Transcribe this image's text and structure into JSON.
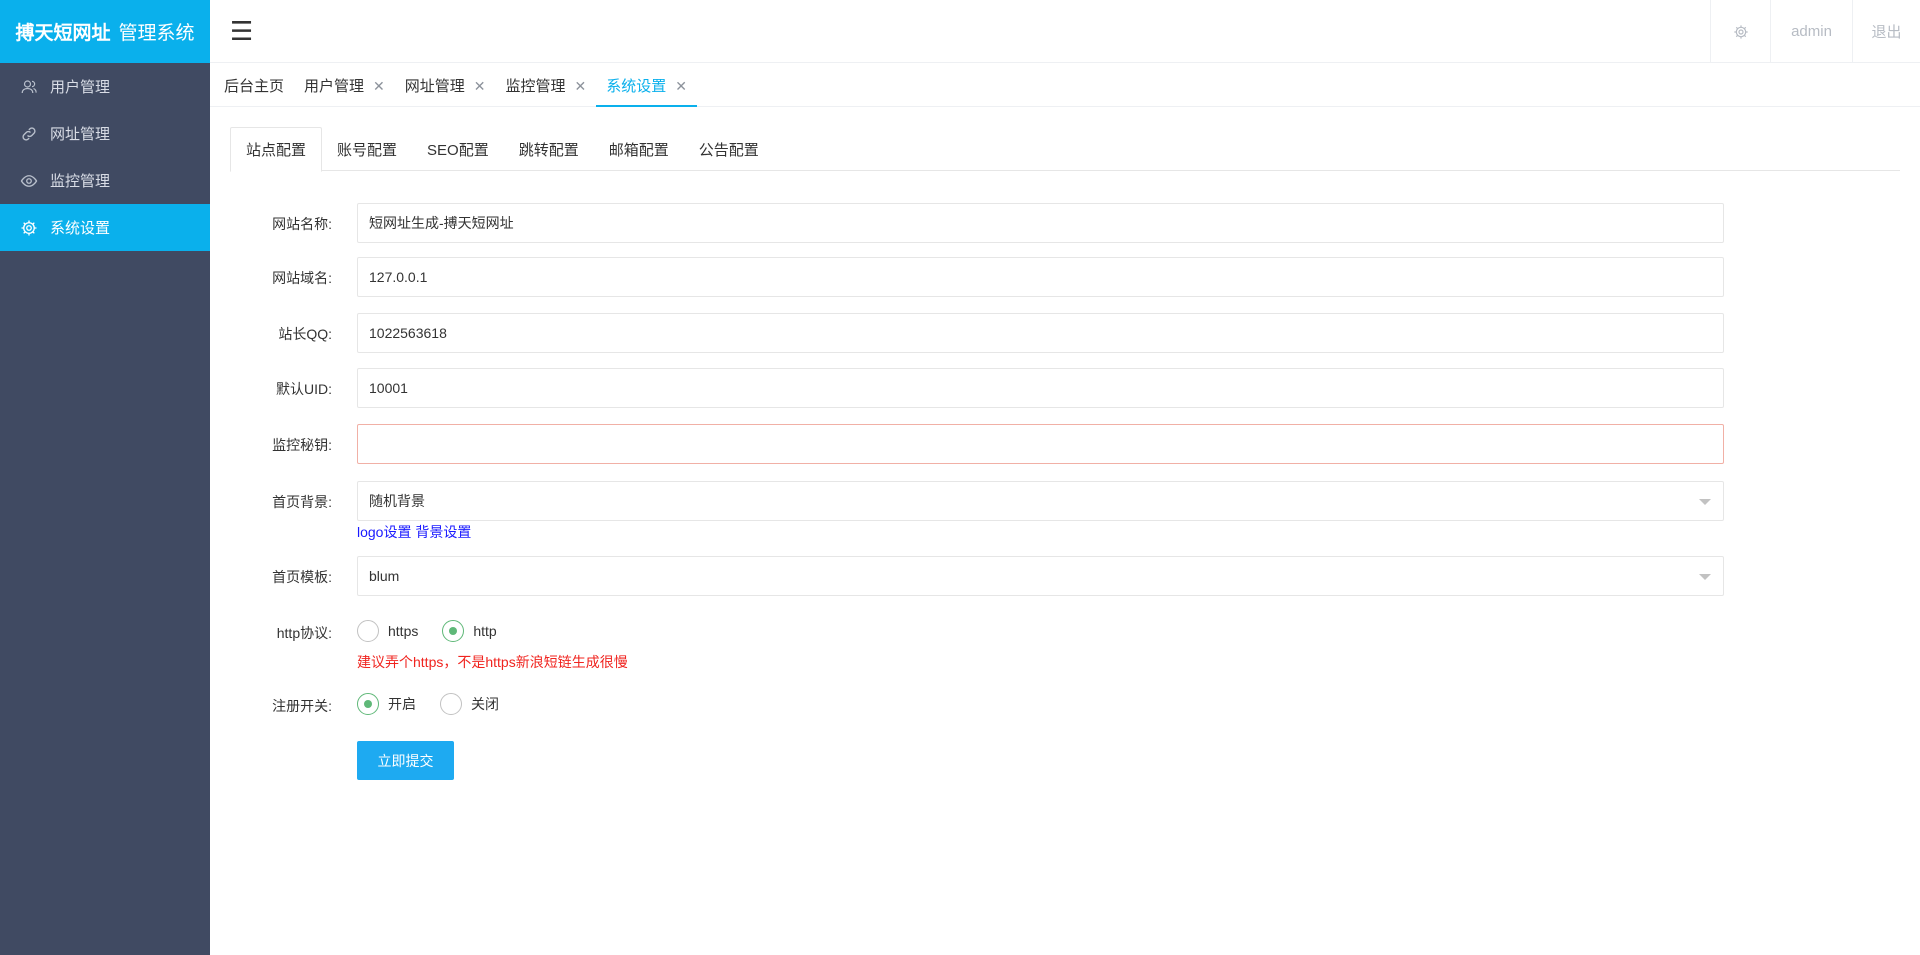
{
  "brand": {
    "name": "搏天短网址",
    "suffix": "管理系统"
  },
  "sidebar": {
    "items": [
      {
        "label": "用户管理",
        "icon": "user-icon",
        "active": false
      },
      {
        "label": "网址管理",
        "icon": "link-icon",
        "active": false
      },
      {
        "label": "监控管理",
        "icon": "eye-icon",
        "active": false
      },
      {
        "label": "系统设置",
        "icon": "gear-icon",
        "active": true
      }
    ]
  },
  "header": {
    "menu_icon": "hamburger-icon",
    "menu_glyph": "☰",
    "settings_icon": "gear-icon",
    "user": "admin",
    "logout": "退出"
  },
  "page_tabs": [
    {
      "label": "后台主页",
      "closable": false,
      "active": false
    },
    {
      "label": "用户管理",
      "closable": true,
      "active": false
    },
    {
      "label": "网址管理",
      "closable": true,
      "active": false
    },
    {
      "label": "监控管理",
      "closable": true,
      "active": false
    },
    {
      "label": "系统设置",
      "closable": true,
      "active": true
    }
  ],
  "close_glyph": "✕",
  "settings_tabs": [
    "站点配置",
    "账号配置",
    "SEO配置",
    "跳转配置",
    "邮箱配置",
    "公告配置"
  ],
  "form": {
    "site_name": {
      "label": "网站名称:",
      "value": "短网址生成-搏天短网址"
    },
    "site_domain": {
      "label": "网站域名:",
      "value": "127.0.0.1"
    },
    "admin_qq": {
      "label": "站长QQ:",
      "value": "1022563618"
    },
    "default_uid": {
      "label": "默认UID:",
      "value": "10001"
    },
    "monitor_key": {
      "label": "监控秘钥:",
      "value": ""
    },
    "home_background": {
      "label": "首页背景:",
      "value": "随机背景"
    },
    "background_links": {
      "logo": "logo设置",
      "background": "背景设置"
    },
    "home_template": {
      "label": "首页模板:",
      "value": "blum"
    },
    "http_protocol": {
      "label": "http协议:",
      "options": [
        "https",
        "http"
      ],
      "selected": "http"
    },
    "https_tip": "建议弄个https，不是https新浪短链生成很慢",
    "register_switch": {
      "label": "注册开关:",
      "options": [
        "开启",
        "关闭"
      ],
      "selected": "开启"
    },
    "submit_label": "立即提交"
  },
  "colors": {
    "accent": "#0ab0ec",
    "sidebar_bg": "#404a62",
    "submit": "#1eaaf1",
    "radio_checked": "#5fb878",
    "warning": "#f0241f",
    "link": "#1a1aff"
  }
}
